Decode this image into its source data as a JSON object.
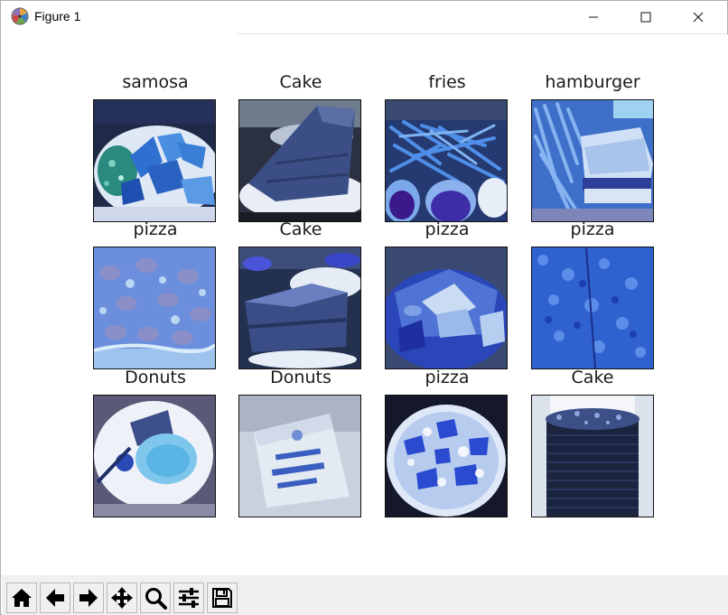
{
  "window": {
    "title": "Figure 1",
    "icon": "matplotlib-logo-icon",
    "controls": [
      "minimize-icon",
      "maximize-icon",
      "close-icon"
    ]
  },
  "figure": {
    "grid_rows": 3,
    "grid_cols": 4,
    "subplots": [
      {
        "title": "samosa"
      },
      {
        "title": "Cake"
      },
      {
        "title": "fries"
      },
      {
        "title": "hamburger"
      },
      {
        "title": "pizza"
      },
      {
        "title": "Cake"
      },
      {
        "title": "pizza"
      },
      {
        "title": "pizza"
      },
      {
        "title": "Donuts"
      },
      {
        "title": "Donuts"
      },
      {
        "title": "pizza"
      },
      {
        "title": "Cake"
      }
    ]
  },
  "toolbar": {
    "buttons": [
      {
        "name": "home-icon",
        "tooltip": "Reset original view"
      },
      {
        "name": "back-arrow-icon",
        "tooltip": "Back"
      },
      {
        "name": "forward-arrow-icon",
        "tooltip": "Forward"
      },
      {
        "name": "pan-move-icon",
        "tooltip": "Pan"
      },
      {
        "name": "zoom-magnifier-icon",
        "tooltip": "Zoom"
      },
      {
        "name": "configure-subplots-icon",
        "tooltip": "Configure subplots"
      },
      {
        "name": "save-floppy-icon",
        "tooltip": "Save"
      }
    ]
  }
}
